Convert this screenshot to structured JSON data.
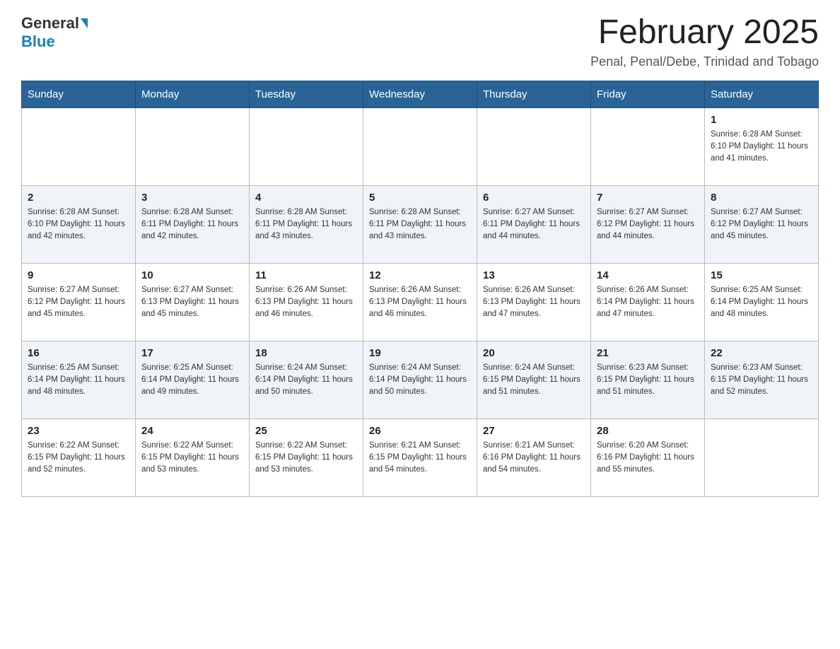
{
  "logo": {
    "general": "General",
    "blue": "Blue"
  },
  "title": {
    "month": "February 2025",
    "location": "Penal, Penal/Debe, Trinidad and Tobago"
  },
  "days_of_week": [
    "Sunday",
    "Monday",
    "Tuesday",
    "Wednesday",
    "Thursday",
    "Friday",
    "Saturday"
  ],
  "weeks": [
    [
      {
        "day": "",
        "info": ""
      },
      {
        "day": "",
        "info": ""
      },
      {
        "day": "",
        "info": ""
      },
      {
        "day": "",
        "info": ""
      },
      {
        "day": "",
        "info": ""
      },
      {
        "day": "",
        "info": ""
      },
      {
        "day": "1",
        "info": "Sunrise: 6:28 AM\nSunset: 6:10 PM\nDaylight: 11 hours and 41 minutes."
      }
    ],
    [
      {
        "day": "2",
        "info": "Sunrise: 6:28 AM\nSunset: 6:10 PM\nDaylight: 11 hours and 42 minutes."
      },
      {
        "day": "3",
        "info": "Sunrise: 6:28 AM\nSunset: 6:11 PM\nDaylight: 11 hours and 42 minutes."
      },
      {
        "day": "4",
        "info": "Sunrise: 6:28 AM\nSunset: 6:11 PM\nDaylight: 11 hours and 43 minutes."
      },
      {
        "day": "5",
        "info": "Sunrise: 6:28 AM\nSunset: 6:11 PM\nDaylight: 11 hours and 43 minutes."
      },
      {
        "day": "6",
        "info": "Sunrise: 6:27 AM\nSunset: 6:11 PM\nDaylight: 11 hours and 44 minutes."
      },
      {
        "day": "7",
        "info": "Sunrise: 6:27 AM\nSunset: 6:12 PM\nDaylight: 11 hours and 44 minutes."
      },
      {
        "day": "8",
        "info": "Sunrise: 6:27 AM\nSunset: 6:12 PM\nDaylight: 11 hours and 45 minutes."
      }
    ],
    [
      {
        "day": "9",
        "info": "Sunrise: 6:27 AM\nSunset: 6:12 PM\nDaylight: 11 hours and 45 minutes."
      },
      {
        "day": "10",
        "info": "Sunrise: 6:27 AM\nSunset: 6:13 PM\nDaylight: 11 hours and 45 minutes."
      },
      {
        "day": "11",
        "info": "Sunrise: 6:26 AM\nSunset: 6:13 PM\nDaylight: 11 hours and 46 minutes."
      },
      {
        "day": "12",
        "info": "Sunrise: 6:26 AM\nSunset: 6:13 PM\nDaylight: 11 hours and 46 minutes."
      },
      {
        "day": "13",
        "info": "Sunrise: 6:26 AM\nSunset: 6:13 PM\nDaylight: 11 hours and 47 minutes."
      },
      {
        "day": "14",
        "info": "Sunrise: 6:26 AM\nSunset: 6:14 PM\nDaylight: 11 hours and 47 minutes."
      },
      {
        "day": "15",
        "info": "Sunrise: 6:25 AM\nSunset: 6:14 PM\nDaylight: 11 hours and 48 minutes."
      }
    ],
    [
      {
        "day": "16",
        "info": "Sunrise: 6:25 AM\nSunset: 6:14 PM\nDaylight: 11 hours and 48 minutes."
      },
      {
        "day": "17",
        "info": "Sunrise: 6:25 AM\nSunset: 6:14 PM\nDaylight: 11 hours and 49 minutes."
      },
      {
        "day": "18",
        "info": "Sunrise: 6:24 AM\nSunset: 6:14 PM\nDaylight: 11 hours and 50 minutes."
      },
      {
        "day": "19",
        "info": "Sunrise: 6:24 AM\nSunset: 6:14 PM\nDaylight: 11 hours and 50 minutes."
      },
      {
        "day": "20",
        "info": "Sunrise: 6:24 AM\nSunset: 6:15 PM\nDaylight: 11 hours and 51 minutes."
      },
      {
        "day": "21",
        "info": "Sunrise: 6:23 AM\nSunset: 6:15 PM\nDaylight: 11 hours and 51 minutes."
      },
      {
        "day": "22",
        "info": "Sunrise: 6:23 AM\nSunset: 6:15 PM\nDaylight: 11 hours and 52 minutes."
      }
    ],
    [
      {
        "day": "23",
        "info": "Sunrise: 6:22 AM\nSunset: 6:15 PM\nDaylight: 11 hours and 52 minutes."
      },
      {
        "day": "24",
        "info": "Sunrise: 6:22 AM\nSunset: 6:15 PM\nDaylight: 11 hours and 53 minutes."
      },
      {
        "day": "25",
        "info": "Sunrise: 6:22 AM\nSunset: 6:15 PM\nDaylight: 11 hours and 53 minutes."
      },
      {
        "day": "26",
        "info": "Sunrise: 6:21 AM\nSunset: 6:15 PM\nDaylight: 11 hours and 54 minutes."
      },
      {
        "day": "27",
        "info": "Sunrise: 6:21 AM\nSunset: 6:16 PM\nDaylight: 11 hours and 54 minutes."
      },
      {
        "day": "28",
        "info": "Sunrise: 6:20 AM\nSunset: 6:16 PM\nDaylight: 11 hours and 55 minutes."
      },
      {
        "day": "",
        "info": ""
      }
    ]
  ]
}
